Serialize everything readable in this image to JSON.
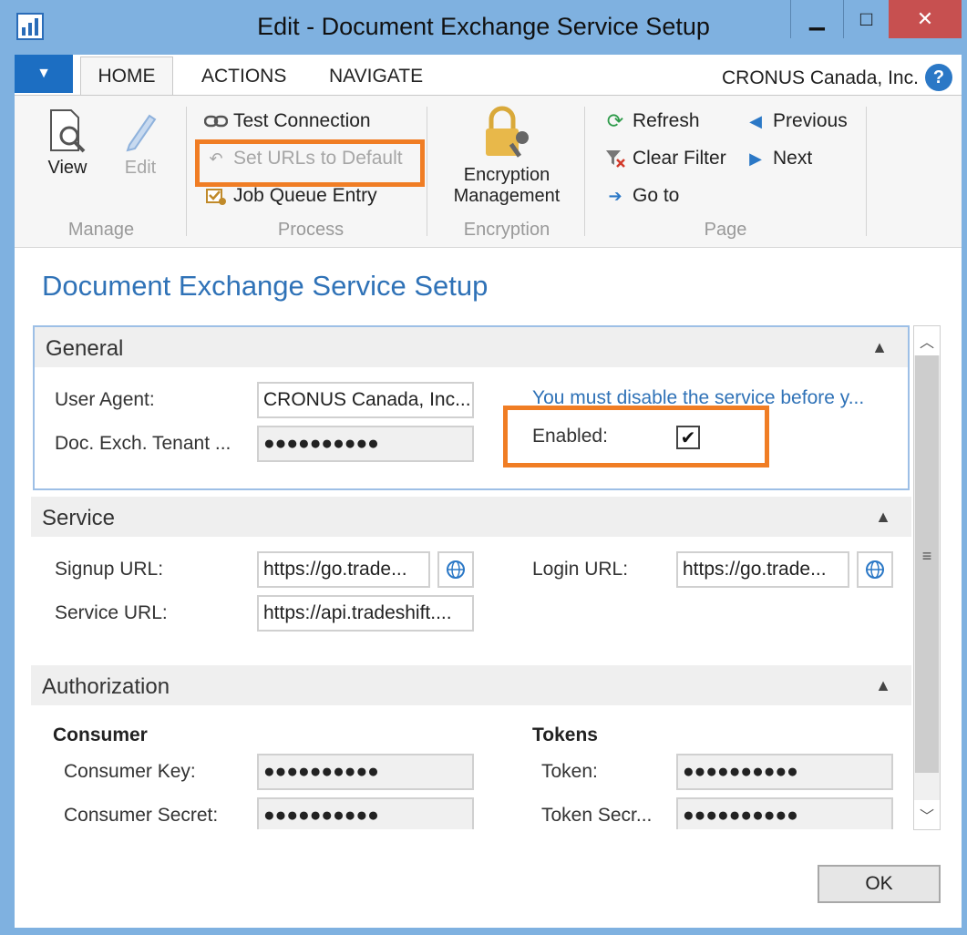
{
  "window": {
    "title": "Edit - Document Exchange Service Setup",
    "minimize_glyph": "▁",
    "maximize_glyph": "□",
    "close_glyph": "✕"
  },
  "ribbon": {
    "tabs": [
      {
        "label": "HOME",
        "selected": true
      },
      {
        "label": "ACTIONS",
        "selected": false
      },
      {
        "label": "NAVIGATE",
        "selected": false
      }
    ],
    "company": "CRONUS Canada, Inc.",
    "help_glyph": "?",
    "groups": {
      "manage": {
        "label": "Manage",
        "view_label": "View",
        "edit_label": "Edit"
      },
      "process": {
        "label": "Process",
        "test_connection": "Test Connection",
        "set_urls_default": "Set URLs to Default",
        "job_queue_entry": "Job Queue Entry"
      },
      "encryption": {
        "label": "Encryption",
        "button_line1": "Encryption",
        "button_line2": "Management"
      },
      "page": {
        "label": "Page",
        "refresh": "Refresh",
        "clear_filter": "Clear Filter",
        "go_to": "Go to",
        "previous": "Previous",
        "next": "Next"
      }
    },
    "highlight_color": "#f07d24"
  },
  "page": {
    "title": "Document Exchange Service Setup"
  },
  "general": {
    "title": "General",
    "user_agent_label": "User Agent:",
    "user_agent_value": "CRONUS Canada, Inc...",
    "tenant_label": "Doc. Exch. Tenant ...",
    "tenant_value": "●●●●●●●●●●",
    "warning": "You must disable the service before y...",
    "enabled_label": "Enabled:",
    "enabled_checked": true,
    "check_glyph": "✔"
  },
  "service": {
    "title": "Service",
    "signup_label": "Signup URL:",
    "signup_value": "https://go.trade...",
    "service_label": "Service URL:",
    "service_value": "https://api.tradeshift....",
    "login_label": "Login URL:",
    "login_value": "https://go.trade..."
  },
  "authorization": {
    "title": "Authorization",
    "consumer_heading": "Consumer",
    "consumer_key_label": "Consumer Key:",
    "consumer_key_value": "●●●●●●●●●●",
    "consumer_secret_label": "Consumer Secret:",
    "consumer_secret_value": "●●●●●●●●●●",
    "tokens_heading": "Tokens",
    "token_label": "Token:",
    "token_value": "●●●●●●●●●●",
    "token_secret_label": "Token Secr...",
    "token_secret_value": "●●●●●●●●●●"
  },
  "footer": {
    "ok_label": "OK"
  },
  "colors": {
    "accent_blue": "#2f72b7",
    "titlebar": "#7fb1e0",
    "close_button": "#c75050"
  }
}
